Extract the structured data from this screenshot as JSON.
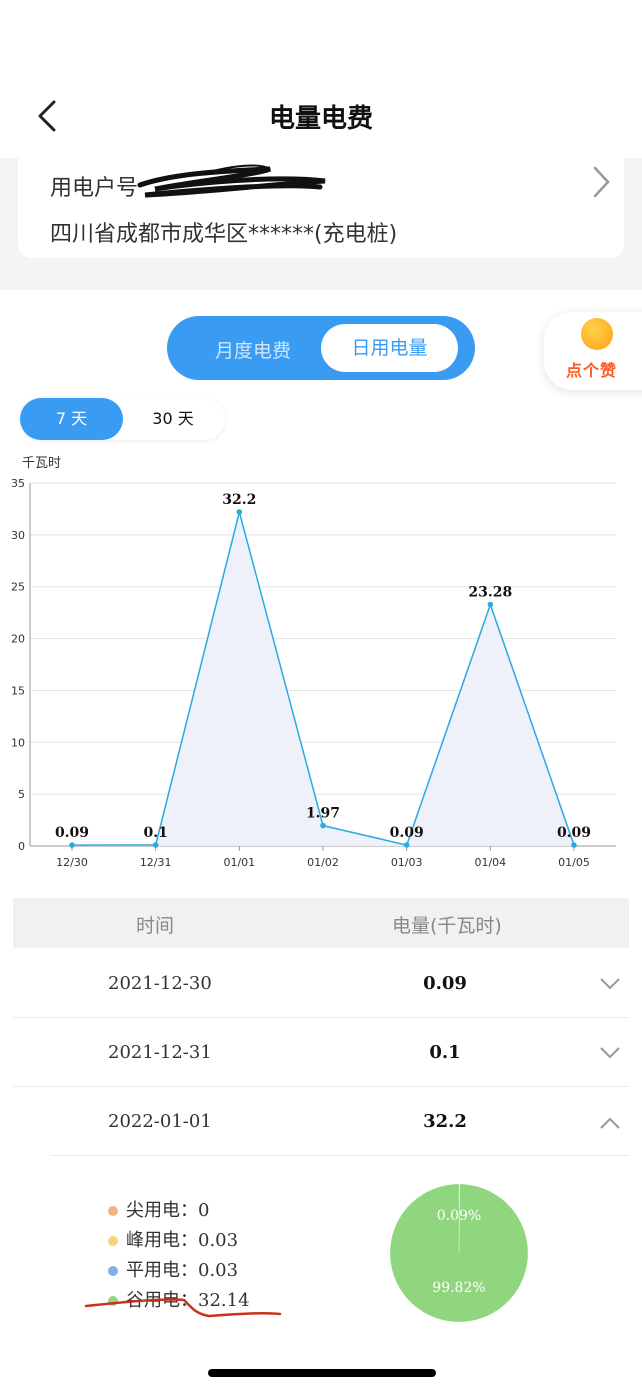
{
  "header": {
    "title": "电量电费"
  },
  "account": {
    "label": "用电户号",
    "address": "四川省成都市成华区******(充电桩)"
  },
  "tabs": {
    "month": "月度电费",
    "day": "日用电量",
    "active": "day"
  },
  "like_badge": {
    "label": "点个赞"
  },
  "range": {
    "options": [
      "7 天",
      "30 天"
    ],
    "active": "7 天"
  },
  "chart_data": {
    "type": "area",
    "ylabel": "千瓦时",
    "categories": [
      "12/30",
      "12/31",
      "01/01",
      "01/02",
      "01/03",
      "01/04",
      "01/05"
    ],
    "values": [
      0.09,
      0.1,
      32.2,
      1.97,
      0.09,
      23.28,
      0.09
    ],
    "value_labels": [
      "0.09",
      "0.1",
      "32.2",
      "1.97",
      "0.09",
      "23.28",
      "0.09"
    ],
    "ylim": [
      0,
      35
    ],
    "yticks": [
      0,
      5,
      10,
      15,
      20,
      25,
      30,
      35
    ],
    "grid": true,
    "line_color": "#2aa9e0",
    "fill_color": "#eef1fa"
  },
  "table": {
    "headers": [
      "时间",
      "电量(千瓦时)"
    ],
    "rows": [
      {
        "date": "2021-12-30",
        "value": "0.09",
        "expanded": false
      },
      {
        "date": "2021-12-31",
        "value": "0.1",
        "expanded": false
      },
      {
        "date": "2022-01-01",
        "value": "32.2",
        "expanded": true
      }
    ]
  },
  "breakdown": {
    "items": [
      {
        "label": "尖用电：",
        "value": "0",
        "color": "#f4b183"
      },
      {
        "label": "峰用电：",
        "value": "0.03",
        "color": "#f3d67a"
      },
      {
        "label": "平用电：",
        "value": "0.03",
        "color": "#7fb2e5"
      },
      {
        "label": "谷用电：",
        "value": "32.14",
        "color": "#8fd67f"
      }
    ],
    "pie": {
      "slices": [
        {
          "name": "尖用电",
          "percent": 0,
          "color": "#f4b183"
        },
        {
          "name": "峰用电",
          "percent": 0.09,
          "color": "#f3d67a"
        },
        {
          "name": "平用电",
          "percent": 0.09,
          "color": "#7fb2e5"
        },
        {
          "name": "谷用电",
          "percent": 99.82,
          "color": "#8fd67f"
        }
      ],
      "labels": [
        "0.09%",
        "99.82%"
      ]
    }
  }
}
